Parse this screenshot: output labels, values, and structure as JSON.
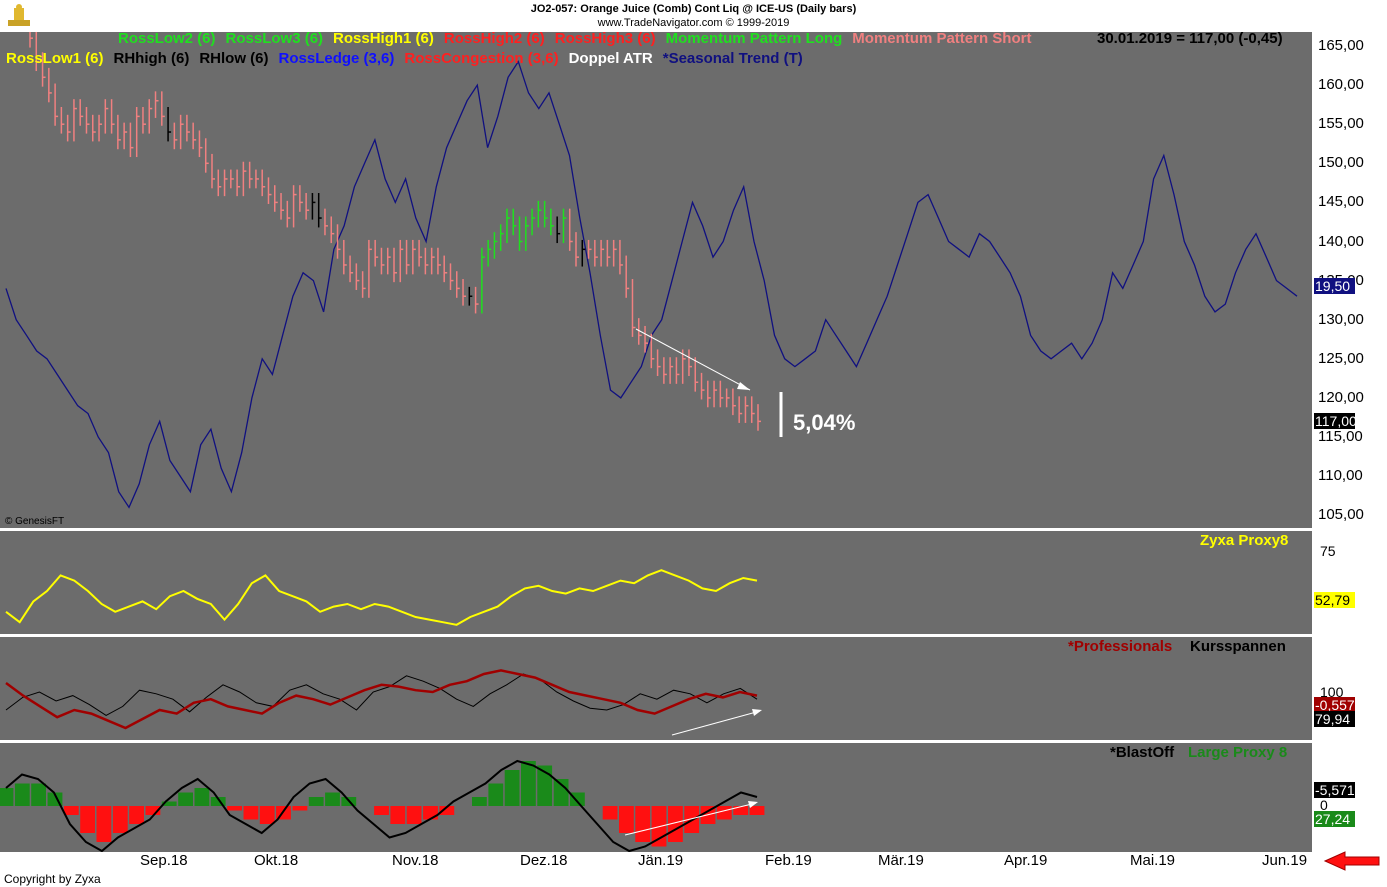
{
  "header": {
    "title": "JO2-057:  Orange Juice (Comb) Cont Liq @ ICE-US  (Daily bars)",
    "subtitle": "www.TradeNavigator.com © 1999-2019",
    "price_readout": "30.01.2019 = 117,00 (-0,45)"
  },
  "legend_row1": [
    {
      "label": "RossLow2 (6)",
      "color": "#1fe01f"
    },
    {
      "label": "RossLow3 (6)",
      "color": "#1fe01f"
    },
    {
      "label": "RossHigh1 (6)",
      "color": "#ffff00"
    },
    {
      "label": "RossHigh2 (6)",
      "color": "#ff2020"
    },
    {
      "label": "RossHigh3 (6)",
      "color": "#ff2020"
    },
    {
      "label": "Momentum Pattern Long",
      "color": "#1fe01f"
    },
    {
      "label": "Momentum Pattern Short",
      "color": "#f08080"
    }
  ],
  "legend_row2": [
    {
      "label": "RossLow1 (6)",
      "color": "#ffff00"
    },
    {
      "label": "RHhigh (6)",
      "color": "#000000"
    },
    {
      "label": "RHlow (6)",
      "color": "#000000"
    },
    {
      "label": "RossLedge (3,6)",
      "color": "#1010ff"
    },
    {
      "label": "RossCongestion (3,6)",
      "color": "#ff2020"
    },
    {
      "label": "Doppel ATR",
      "color": "#ffffff"
    },
    {
      "label": "*Seasonal Trend (T)",
      "color": "#101080"
    }
  ],
  "price_axis": [
    "165,00",
    "160,00",
    "155,00",
    "150,00",
    "145,00",
    "140,00",
    "135,00",
    "130,00",
    "125,00",
    "120,00",
    "115,00",
    "110,00",
    "105,00"
  ],
  "price_badges": {
    "seasonal": "19,50",
    "last": "117,00"
  },
  "annotation": "5,04%",
  "genesis": "© GenesisFT",
  "months": [
    "Sep.18",
    "Okt.18",
    "Nov.18",
    "Dez.18",
    "Jän.19",
    "Feb.19",
    "Mär.19",
    "Apr.19",
    "Mai.19",
    "Jun.19"
  ],
  "copyright": "Copyright by Zyxa",
  "panels": {
    "zyxa": {
      "title": "Zyxa Proxy8",
      "axis_label": "75",
      "value": "52,79"
    },
    "professionals": {
      "title1": "*Professionals",
      "title2": "Kursspannen",
      "axis_label": "100",
      "value1": "-0,5571",
      "value2": "79,94"
    },
    "blastoff": {
      "title1": "*BlastOff",
      "title2": "Large Proxy 8",
      "axis_label": "0",
      "value1": "-5,5718",
      "value2": "27,24"
    }
  },
  "colors": {
    "price_short": "#f08080",
    "price_long": "#1fe01f",
    "price_neutral": "#000000",
    "seasonal": "#101080",
    "zyxa": "#ffff00",
    "professionals": "#a00000",
    "kursspannen": "#000000",
    "hist_pos": "#1a8a1a",
    "hist_neg": "#ff1010"
  },
  "chart_data": {
    "type": "line",
    "title": "JO2-057:  Orange Juice (Comb) Cont Liq @ ICE-US  (Daily bars)",
    "ylim": [
      105,
      165
    ],
    "price_closes": [
      166,
      163,
      161,
      159,
      156,
      155,
      154,
      157,
      156,
      155,
      154,
      155,
      157,
      155,
      153,
      154,
      152,
      156,
      155,
      157,
      158,
      156,
      154,
      153,
      155,
      154,
      153,
      152,
      150,
      148,
      147,
      148,
      148,
      147,
      149,
      148,
      148,
      147,
      146,
      145,
      144,
      143,
      146,
      145,
      144,
      145,
      143,
      142,
      141,
      139,
      137,
      136,
      135,
      134,
      139,
      138,
      137,
      138,
      136,
      139,
      137,
      139,
      138,
      137,
      138,
      137,
      136,
      135,
      134,
      133,
      133,
      132,
      138,
      139,
      140,
      141,
      143,
      142,
      140,
      142,
      143,
      144,
      143,
      142,
      141,
      143,
      140,
      138,
      139,
      139,
      138,
      139,
      138,
      139,
      137,
      134,
      129,
      128,
      127,
      125,
      124,
      123,
      124,
      123,
      125,
      124,
      122,
      121,
      120,
      121,
      120,
      120,
      119,
      118,
      119,
      118,
      117
    ],
    "seasonal_series": [
      134,
      130,
      128,
      126,
      125,
      123,
      121,
      119,
      118,
      115,
      113,
      108,
      106,
      109,
      114,
      117,
      112,
      110,
      108,
      114,
      116,
      111,
      108,
      113,
      120,
      125,
      123,
      128,
      133,
      136,
      135,
      131,
      139,
      142,
      147,
      150,
      153,
      148,
      145,
      148,
      143,
      140,
      147,
      152,
      155,
      158,
      160,
      152,
      156,
      161,
      163,
      159,
      157,
      159,
      155,
      151,
      143,
      136,
      128,
      121,
      120,
      122,
      124,
      128,
      130,
      135,
      140,
      145,
      142,
      138,
      140,
      144,
      147,
      140,
      135,
      128,
      125,
      124,
      125,
      126,
      130,
      128,
      126,
      124,
      127,
      130,
      133,
      137,
      141,
      145,
      146,
      143,
      140,
      139,
      138,
      141,
      140,
      138,
      136,
      133,
      128,
      126,
      125,
      126,
      127,
      125,
      127,
      130,
      136,
      134,
      137,
      140,
      148,
      151,
      146,
      140,
      137,
      133,
      131,
      132,
      136,
      139,
      141,
      138,
      135,
      134,
      133
    ],
    "zyxa_series": [
      52,
      48,
      56,
      60,
      66,
      64,
      60,
      55,
      52,
      54,
      56,
      53,
      58,
      60,
      57,
      55,
      49,
      55,
      63,
      66,
      60,
      58,
      56,
      52,
      54,
      55,
      53,
      55,
      54,
      52,
      50,
      49,
      48,
      47,
      50,
      52,
      54,
      58,
      61,
      62,
      60,
      59,
      61,
      60,
      62,
      64,
      63,
      66,
      68,
      66,
      64,
      61,
      60,
      63,
      65,
      64
    ],
    "professionals_series": [
      105,
      98,
      92,
      86,
      90,
      88,
      84,
      80,
      85,
      90,
      88,
      94,
      96,
      92,
      90,
      88,
      94,
      98,
      96,
      93,
      97,
      101,
      104,
      103,
      101,
      100,
      104,
      106,
      110,
      112,
      110,
      108,
      104,
      100,
      98,
      96,
      94,
      90,
      88,
      92,
      96,
      99,
      97,
      100,
      98
    ],
    "kursspannen_series": [
      90,
      97,
      100,
      95,
      98,
      93,
      87,
      92,
      101,
      99,
      96,
      89,
      97,
      104,
      100,
      94,
      92,
      101,
      104,
      99,
      96,
      90,
      100,
      103,
      109,
      106,
      102,
      96,
      92,
      99,
      104,
      110,
      107,
      100,
      95,
      91,
      90,
      93,
      99,
      96,
      101,
      99,
      94,
      99,
      102,
      96
    ],
    "blastoff_series": [
      4,
      7,
      6,
      3,
      -4,
      -8,
      -10,
      -7,
      -5,
      -3,
      1,
      4,
      6,
      3,
      -2,
      -4,
      -6,
      -3,
      2,
      5,
      6,
      3,
      -1,
      -4,
      -7,
      -6,
      -4,
      -2,
      1,
      3,
      5,
      8,
      10,
      9,
      7,
      4,
      0,
      -4,
      -8,
      -10,
      -9,
      -7,
      -5,
      -3,
      -1,
      1,
      3,
      2
    ],
    "hist_series": [
      4,
      5,
      5,
      3,
      -2,
      -6,
      -8,
      -6,
      -4,
      -2,
      1,
      3,
      4,
      2,
      -1,
      -3,
      -4,
      -3,
      -1,
      2,
      3,
      2,
      0,
      -2,
      -4,
      -4,
      -3,
      -2,
      0,
      2,
      5,
      8,
      10,
      9,
      6,
      3,
      0,
      -3,
      -6,
      -8,
      -9,
      -8,
      -6,
      -4,
      -3,
      -2,
      -2
    ]
  }
}
